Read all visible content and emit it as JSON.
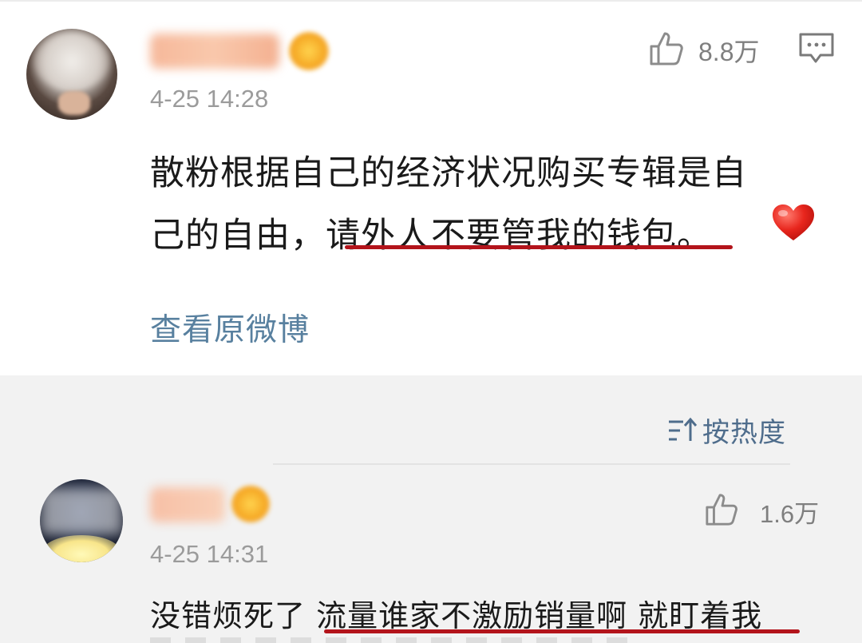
{
  "main_comment": {
    "timestamp": "4-25 14:28",
    "like_count": "8.8万",
    "body_line_1": "散粉根据自己的经济状况购买专辑是自",
    "body_line_2_prefix": "己的自由，",
    "body_line_2_highlight": "请外人不要管我的钱包",
    "body_line_2_suffix": "。",
    "emoji": "red-heart",
    "view_original_label": "查看原微博"
  },
  "replies": {
    "sort_label": "按热度",
    "items": [
      {
        "timestamp": "4-25 14:31",
        "like_count": "1.6万",
        "text_prefix": "没错烦死了 ",
        "text_highlight": "流量谁家不激励销量啊 就盯着我"
      }
    ]
  },
  "colors": {
    "link": "#58809f",
    "highlight_underline": "#b3141b",
    "meta_text": "#9b9b9b",
    "reply_background": "#f2f2f2"
  }
}
